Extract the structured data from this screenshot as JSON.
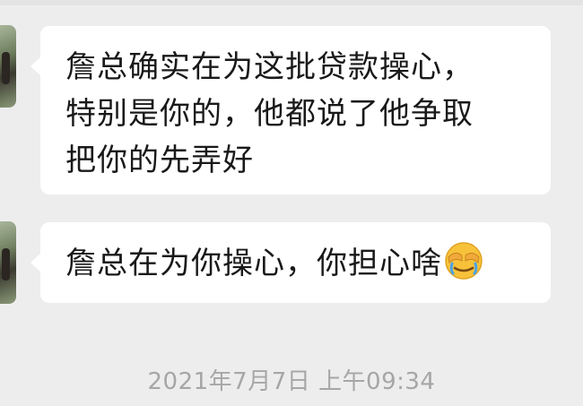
{
  "messages": [
    {
      "text": "詹总确实在为这批贷款操心，\n特别是你的，他都说了他争取\n把你的先弄好"
    },
    {
      "text": "詹总在为你操心，你担心啥",
      "emoji": "face-with-tears-covering-eyes-emoji"
    }
  ],
  "timestamp": "2021年7月7日 上午09:34",
  "colors": {
    "background": "#ededed",
    "bubble": "#ffffff",
    "text": "#191919",
    "timestamp": "#a6a6a6"
  }
}
